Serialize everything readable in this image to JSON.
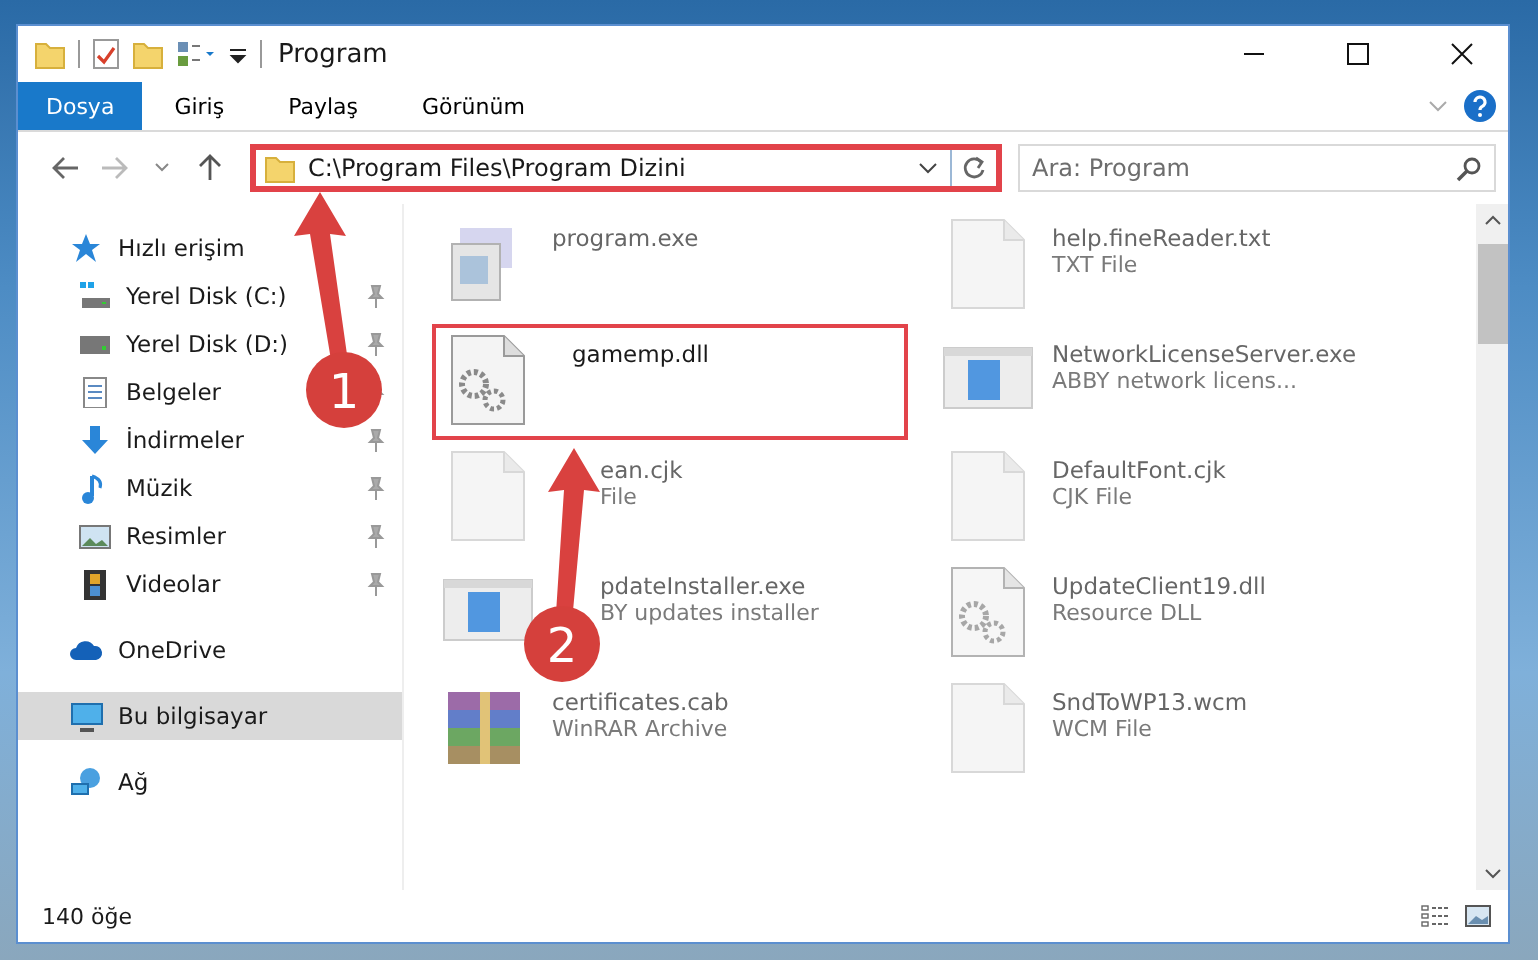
{
  "window": {
    "title": "Program"
  },
  "ribbon_tabs": [
    {
      "label": "Dosya",
      "kind": "file"
    },
    {
      "label": "Giriş",
      "kind": "tab"
    },
    {
      "label": "Paylaş",
      "kind": "tab"
    },
    {
      "label": "Görünüm",
      "kind": "tab"
    }
  ],
  "address": {
    "path": "C:\\Program Files\\Program Dizini",
    "highlighted": true
  },
  "search": {
    "placeholder": "Ara: Program"
  },
  "nav": [
    {
      "label": "Hızlı erişim",
      "kind": "star",
      "selected": false,
      "children": [
        {
          "label": "Yerel Disk (C:)",
          "kind": "drive-c",
          "pinned": true,
          "selected": false
        },
        {
          "label": "Yerel Disk (D:)",
          "kind": "drive",
          "pinned": true,
          "selected": false
        },
        {
          "label": "Belgeler",
          "kind": "docs",
          "pinned": true,
          "selected": false
        },
        {
          "label": "İndirmeler",
          "kind": "download",
          "pinned": true,
          "selected": false
        },
        {
          "label": "Müzik",
          "kind": "music",
          "pinned": true,
          "selected": false
        },
        {
          "label": "Resimler",
          "kind": "pictures",
          "pinned": true,
          "selected": false
        },
        {
          "label": "Videolar",
          "kind": "videos",
          "pinned": true,
          "selected": false
        }
      ]
    },
    {
      "label": "OneDrive",
      "kind": "cloud",
      "selected": false
    },
    {
      "label": "Bu bilgisayar",
      "kind": "pc",
      "selected": true
    },
    {
      "label": "Ağ",
      "kind": "network",
      "selected": false
    }
  ],
  "files": [
    {
      "name": "program.exe",
      "kind": "exe",
      "blurred": true,
      "highlighted": false
    },
    {
      "name": "help.fineReader.txt",
      "type": "TXT File",
      "kind": "blank",
      "blurred": true,
      "highlighted": false
    },
    {
      "name": "gamemp.dll",
      "kind": "dll",
      "blurred": false,
      "highlighted": true
    },
    {
      "name": "NetworkLicenseServer.exe",
      "type": "ABBY network licens...",
      "kind": "window",
      "blurred": true,
      "highlighted": false
    },
    {
      "name": "ean.cjk",
      "type": "File",
      "kind": "blank",
      "blurred": true,
      "highlighted": false
    },
    {
      "name": "DefaultFont.cjk",
      "type": "CJK File",
      "kind": "blank",
      "blurred": true,
      "highlighted": false
    },
    {
      "name": "pdateInstaller.exe",
      "type": "BY updates installer",
      "kind": "window",
      "blurred": true,
      "highlighted": false
    },
    {
      "name": "UpdateClient19.dll",
      "type": "Resource DLL",
      "kind": "dll",
      "blurred": true,
      "highlighted": false
    },
    {
      "name": "certificates.cab",
      "type": "WinRAR Archive",
      "kind": "archive",
      "blurred": true,
      "highlighted": false
    },
    {
      "name": "SndToWP13.wcm",
      "type": "WCM File",
      "kind": "blank",
      "blurred": true,
      "highlighted": false
    }
  ],
  "callouts": [
    {
      "number": "1"
    },
    {
      "number": "2"
    }
  ],
  "status_bar": {
    "count": "140 öğe"
  }
}
